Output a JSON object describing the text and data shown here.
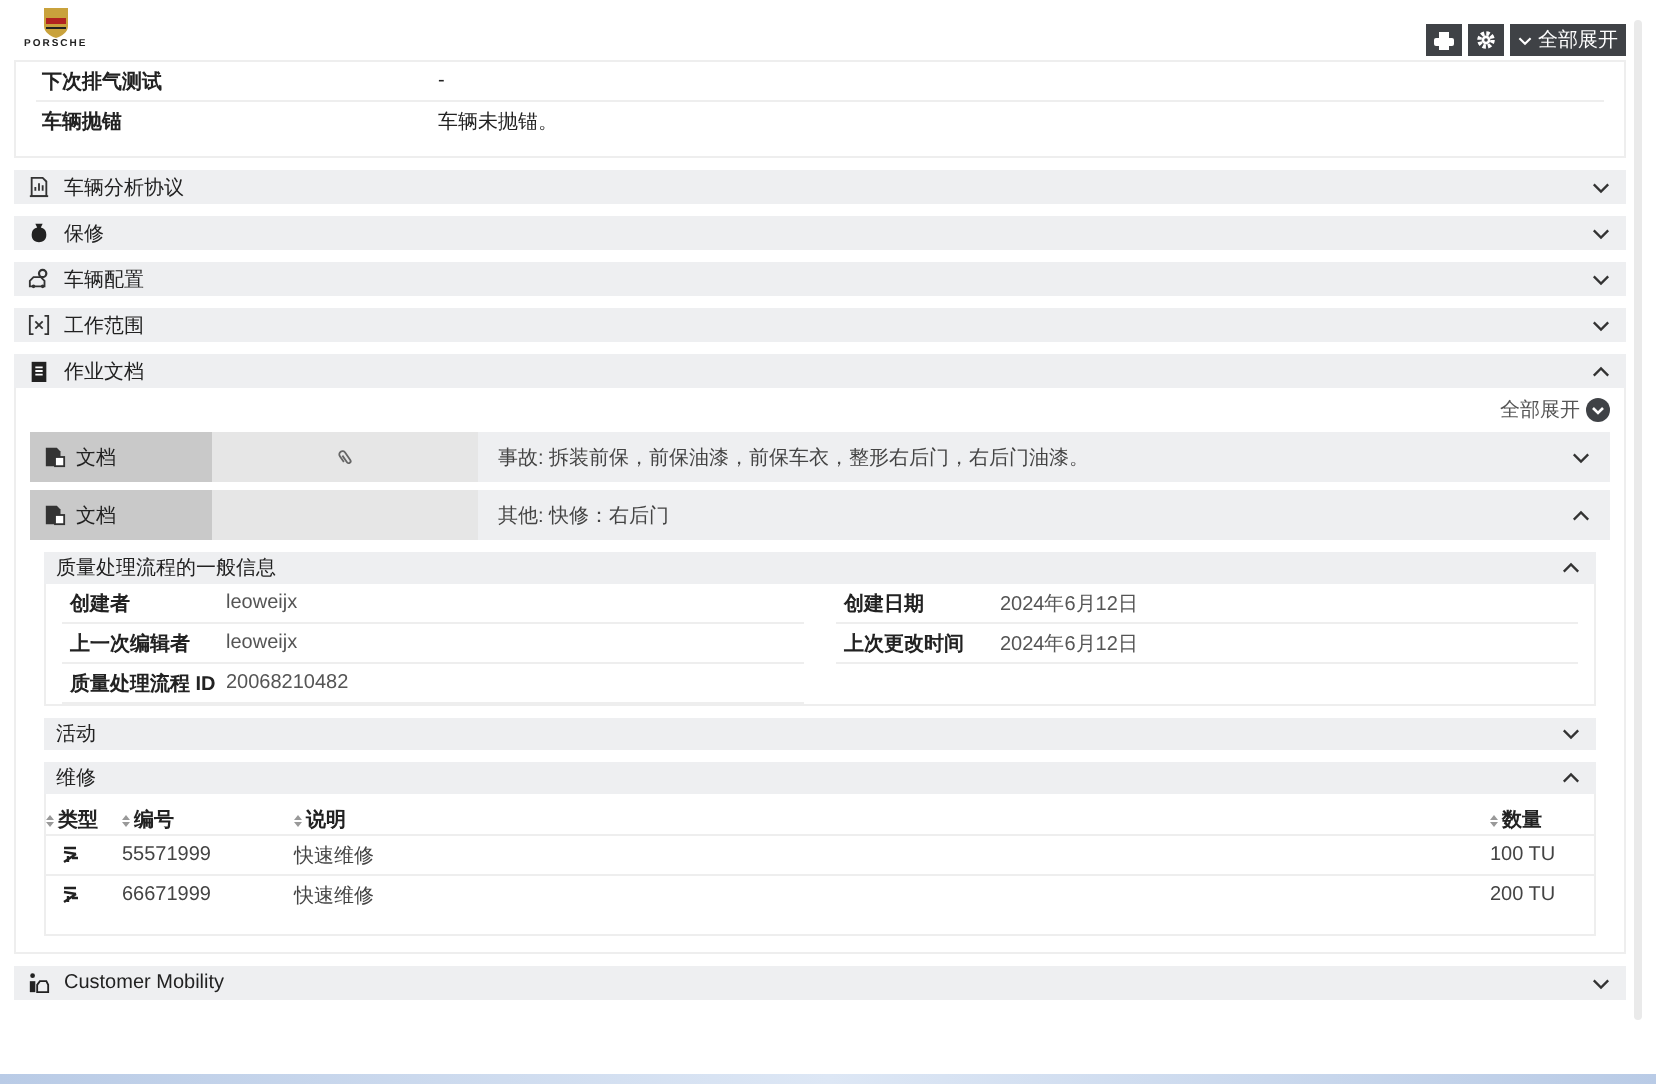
{
  "logo": {
    "wordmark": "PORSCHE"
  },
  "toolbar": {
    "buttons": [
      {
        "kind": "print"
      },
      {
        "kind": "settings"
      }
    ],
    "expand_all": "全部展开"
  },
  "vehicle_info": {
    "rows": [
      {
        "label": "下次排气测试",
        "value": "-"
      },
      {
        "label": "车辆抛锚",
        "value": "车辆未抛锚。"
      }
    ]
  },
  "sections": [
    {
      "kind": "analysis",
      "title": "车辆分析协议",
      "expanded": false
    },
    {
      "kind": "warranty",
      "title": "保修",
      "expanded": false
    },
    {
      "kind": "configuration",
      "title": "车辆配置",
      "expanded": false
    },
    {
      "kind": "scope",
      "title": "工作范围",
      "expanded": false
    },
    {
      "kind": "documents",
      "title": "作业文档",
      "expanded": true,
      "content": {
        "expand_all": "全部展开",
        "documents": [
          {
            "label": "文档",
            "has_attachment": true,
            "description": "事故: 拆装前保，前保油漆，前保车衣，整形右后门，右后门油漆。",
            "expanded": false
          },
          {
            "label": "文档",
            "has_attachment": false,
            "description": "其他: 快修：右后门",
            "expanded": true,
            "panels": [
              {
                "kind": "fields",
                "title": "质量处理流程的一般信息",
                "expanded": true,
                "fields": [
                  {
                    "label": "创建者",
                    "value": "leoweijx"
                  },
                  {
                    "label": "创建日期",
                    "value": "2024年6月12日"
                  },
                  {
                    "label": "上一次编辑者",
                    "value": "leoweijx"
                  },
                  {
                    "label": "上次更改时间",
                    "value": "2024年6月12日"
                  },
                  {
                    "label": "质量处理流程 ID",
                    "value": "20068210482"
                  }
                ]
              },
              {
                "title": "活动",
                "expanded": false
              },
              {
                "kind": "table",
                "title": "维修",
                "expanded": true,
                "columns": [
                  "类型",
                  "编号",
                  "说明",
                  "数量"
                ],
                "rows": [
                  {
                    "number": "55571999",
                    "description": "快速维修",
                    "quantity": "100 TU"
                  },
                  {
                    "number": "66671999",
                    "description": "快速维修",
                    "quantity": "200 TU"
                  }
                ]
              }
            ]
          }
        ]
      }
    },
    {
      "kind": "mobility",
      "title": "Customer Mobility",
      "expanded": false
    }
  ]
}
